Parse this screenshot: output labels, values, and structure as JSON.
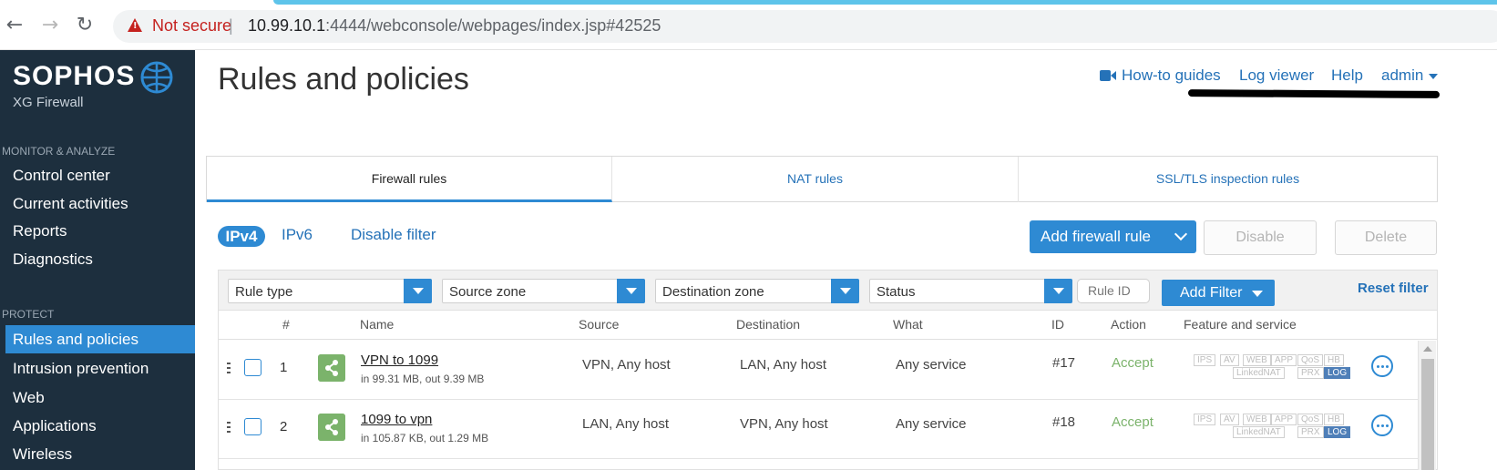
{
  "browser": {
    "back_glyph": "←",
    "forward_glyph": "→",
    "reload_glyph": "↻",
    "security_label": "Not secure",
    "url_separator": "|",
    "url_host": "10.99.10.1",
    "url_rest": ":4444/webconsole/webpages/index.jsp#42525",
    "warning_color": "#c5221f"
  },
  "sidebar": {
    "brand": "SOPHOS",
    "product": "XG Firewall",
    "sections": [
      {
        "heading": "MONITOR & ANALYZE",
        "items": [
          "Control center",
          "Current activities",
          "Reports",
          "Diagnostics"
        ]
      },
      {
        "heading": "PROTECT",
        "items": [
          "Rules and policies",
          "Intrusion prevention",
          "Web",
          "Applications",
          "Wireless"
        ]
      }
    ],
    "active_item": "Rules and policies",
    "background": "#1d2f3e",
    "accent": "#2e8ad3"
  },
  "header": {
    "title": "Rules and policies",
    "links": {
      "howto": "How-to guides",
      "logviewer": "Log viewer",
      "help": "Help",
      "user": "admin"
    }
  },
  "tabs": [
    {
      "label": "Firewall rules",
      "active": true
    },
    {
      "label": "NAT rules",
      "active": false
    },
    {
      "label": "SSL/TLS inspection rules",
      "active": false
    }
  ],
  "toolbar": {
    "ipv4": "IPv4",
    "ipv6": "IPv6",
    "disable_filter": "Disable filter",
    "add_rule": "Add firewall rule",
    "disable": "Disable",
    "delete": "Delete"
  },
  "filters": {
    "rule_type": "Rule type",
    "source_zone": "Source zone",
    "destination_zone": "Destination zone",
    "status": "Status",
    "rule_id_placeholder": "Rule ID",
    "add_filter": "Add Filter",
    "reset_filter": "Reset filter"
  },
  "table": {
    "columns": [
      "#",
      "Name",
      "Source",
      "Destination",
      "What",
      "ID",
      "Action",
      "Feature and service"
    ],
    "rows": [
      {
        "num": "1",
        "name": "VPN to 1099",
        "traffic": "in 99.31 MB, out 9.39 MB",
        "source": "VPN, Any host",
        "destination": "LAN, Any host",
        "what": "Any service",
        "id": "#17",
        "action": "Accept"
      },
      {
        "num": "2",
        "name": "1099 to vpn",
        "traffic": "in 105.87 KB, out 1.29 MB",
        "source": "LAN, Any host",
        "destination": "VPN, Any host",
        "what": "Any service",
        "id": "#18",
        "action": "Accept"
      }
    ],
    "feature_badges": {
      "ips": "IPS",
      "av": "AV",
      "web": "WEB",
      "app": "APP",
      "qos": "QoS",
      "hb": "HB",
      "linkednat": "LinkedNAT",
      "prx": "PRX",
      "log": "LOG"
    },
    "accept_color": "#7bb36b"
  }
}
